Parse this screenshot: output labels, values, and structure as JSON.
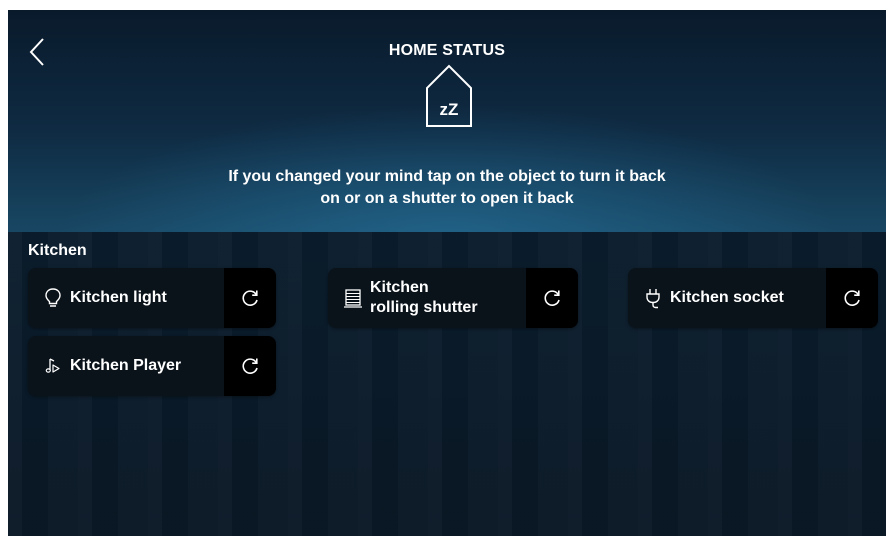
{
  "header": {
    "title": "HOME STATUS",
    "mode_icon": "house-sleep-icon",
    "mode_icon_text": "zZ",
    "message_line1": "If you changed your mind tap on the object to turn it back",
    "message_line2": "on or on a shutter to open it back"
  },
  "room": {
    "name": "Kitchen",
    "items": [
      {
        "label": "Kitchen light",
        "icon": "lightbulb-icon",
        "action_icon": "refresh-icon"
      },
      {
        "label": "Kitchen\nrolling shutter",
        "icon": "shutter-icon",
        "action_icon": "refresh-icon"
      },
      {
        "label": "Kitchen socket",
        "icon": "plug-icon",
        "action_icon": "refresh-icon"
      },
      {
        "label": "Kitchen Player",
        "icon": "music-note-icon",
        "action_icon": "refresh-icon"
      }
    ]
  },
  "colors": {
    "text": "#ffffff",
    "tile_bg": "#0a121a",
    "header_glow": "#2878a5"
  }
}
